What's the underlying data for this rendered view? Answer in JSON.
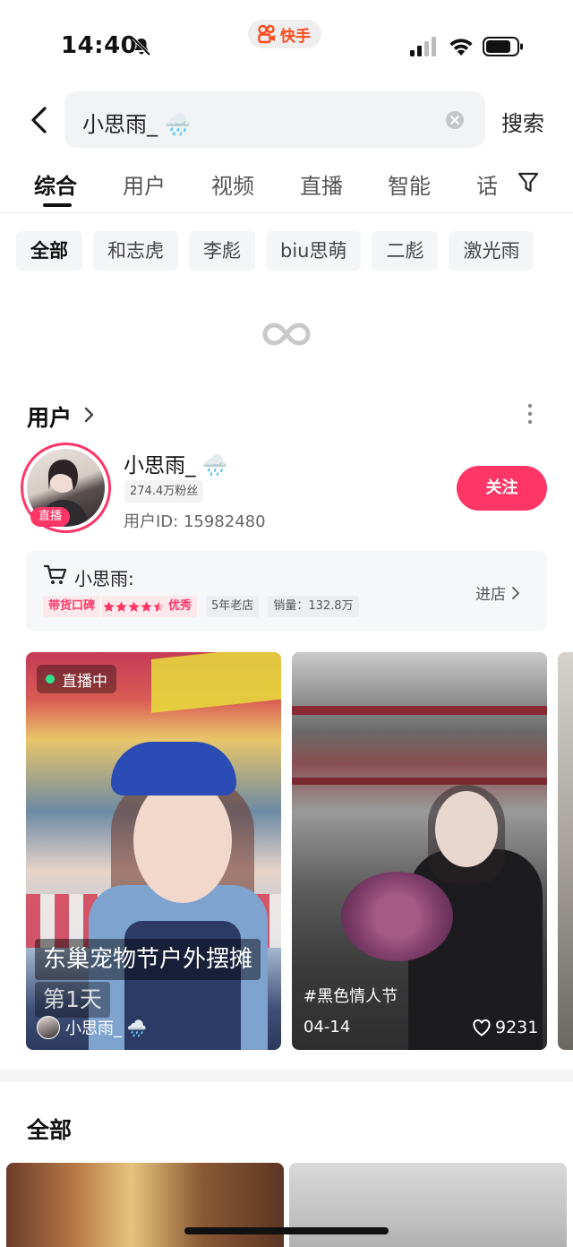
{
  "status_bar": {
    "time": "14:40",
    "app_name": "快手",
    "app_color": "#ff4a1a"
  },
  "search": {
    "query": "小思雨_ 🌧️",
    "submit_label": "搜索"
  },
  "tabs": [
    "综合",
    "用户",
    "视频",
    "直播",
    "智能",
    "话"
  ],
  "active_tab": "综合",
  "filter_chips": [
    "全部",
    "和志虎",
    "李彪",
    "biu思萌",
    "二彪",
    "激光雨"
  ],
  "users_section": {
    "title": "用户"
  },
  "user": {
    "name": "小思雨_ 🌧️",
    "live_badge": "直播",
    "fans": "274.4万粉丝",
    "user_id": "用户ID: 15982480",
    "follow_label": "关注",
    "accent_color": "#fe3666"
  },
  "shop": {
    "name": "小思雨:",
    "reputation_label": "带货口碑",
    "rating_stars": 4.5,
    "rating_level": "优秀",
    "age_tag": "5年老店",
    "sales_tag": "销量：132.8万",
    "enter_label": "进店"
  },
  "videos": [
    {
      "live_label": "直播中",
      "title_line1": "东巢宠物节户外摆摊",
      "title_line2": "第1天",
      "author": "小思雨_ 🌧️"
    },
    {
      "tag": "#黑色情人节",
      "date": "04-14",
      "likes": "9231"
    }
  ],
  "all_section": {
    "title": "全部"
  }
}
